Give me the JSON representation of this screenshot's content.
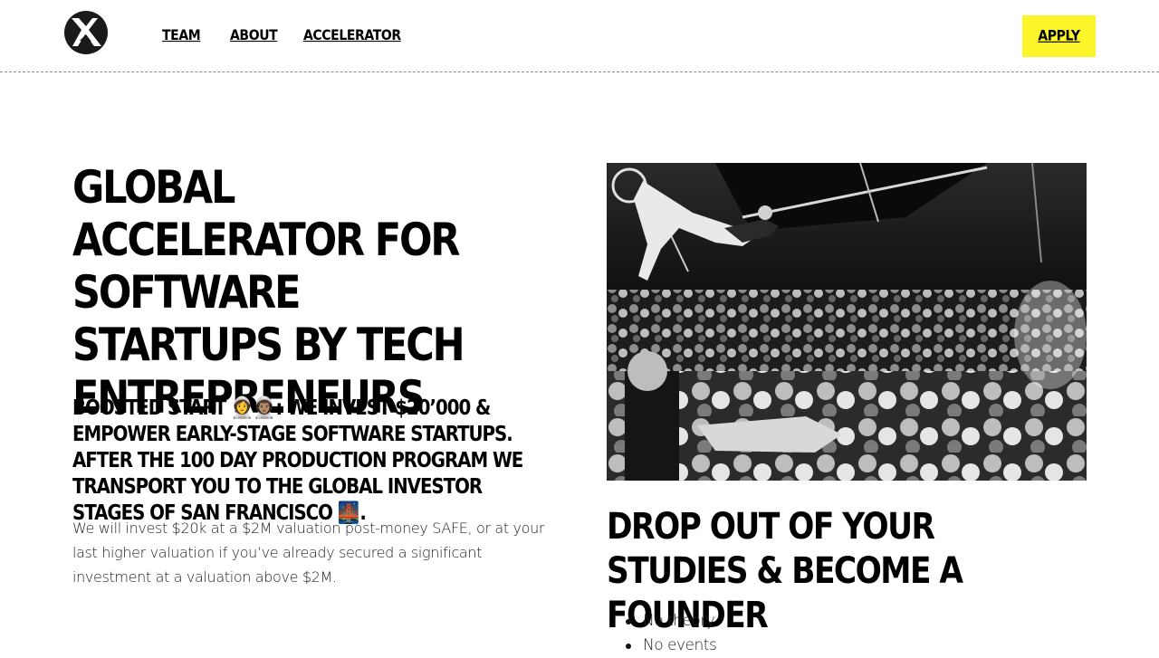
{
  "header": {
    "logo_label": "X logo",
    "nav": [
      "TEAM",
      "ABOUT",
      "ACCELERATOR"
    ],
    "apply_label": "APPLY"
  },
  "hero": {
    "title": "GLOBAL ACCELERATOR FOR SOFTWARE STARTUPS BY TECH ENTREPRENEURS",
    "subtitle_part1": "BOOSTED START",
    "emoji_astronauts": "👩‍🚀👨🏽‍🚀",
    "subtitle_part2": ": WE INVEST $20’000 & EMPOWER EARLY-STAGE SOFTWARE STARTUPS. AFTER THE 100 DAY PRODUCTION PROGRAM WE TRANSPORT YOU TO THE GLOBAL INVESTOR STAGES OF SAN FRANCISCO",
    "emoji_bridge": "🌉",
    "subtitle_end": ".",
    "body": "We will invest $20k at a $2M valuation post-money SAFE, or at your last higher valuation if you’ve already secured a significant investment at a valuation above $2M."
  },
  "section": {
    "title": "DROP OUT OF YOUR STUDIES & BECOME A FOUNDER",
    "bullets": [
      "No theory",
      "No events"
    ]
  },
  "colors": {
    "accent": "#fbf52a",
    "text": "#000000",
    "border": "#8a8a8a"
  }
}
